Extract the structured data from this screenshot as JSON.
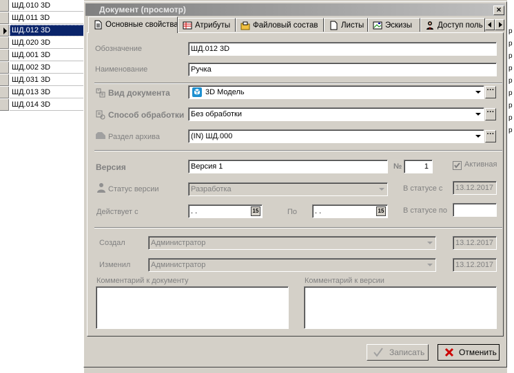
{
  "list": {
    "rows": [
      "ШД.010 3D",
      "ШД.011 3D",
      "ШД.012 3D",
      "ШД.020 3D",
      "ШД.001 3D",
      "ШД.002 3D",
      "ШД.031 3D",
      "ШД.013 3D",
      "ШД.014 3D"
    ],
    "selected_index": 2,
    "right_column_fragments": [
      "p",
      "p",
      "p",
      "p",
      "p",
      "p",
      "p",
      "p",
      "p"
    ]
  },
  "dialog": {
    "title": "Документ (просмотр)",
    "close_label": "×",
    "tabs": [
      {
        "label": "Основные свойства",
        "icon": "document-icon",
        "active": true
      },
      {
        "label": "Атрибуты",
        "icon": "attributes-table-icon"
      },
      {
        "label": "Файловый состав",
        "icon": "folder-files-icon"
      },
      {
        "label": "Листы",
        "icon": "sheet-icon"
      },
      {
        "label": "Эскизы",
        "icon": "sketch-image-icon"
      },
      {
        "label": "Доступ поль",
        "icon": "user-access-icon"
      }
    ],
    "designation": {
      "label": "Обозначение",
      "value": "ШД.012 3D"
    },
    "name": {
      "label": "Наименование",
      "value": "Ручка"
    },
    "doc_type": {
      "label": "Вид документа",
      "value": "3D Модель",
      "icon": "3d-model-cube-icon",
      "ellipsis": "···"
    },
    "processing": {
      "label": "Способ обработки",
      "value": "Без обработки",
      "ellipsis": "···"
    },
    "archive_section": {
      "label": "Раздел архива",
      "value": "(IN) ШД.000",
      "ellipsis": "···"
    },
    "version": {
      "label": "Версия",
      "value": "Версия 1",
      "number_label": "№",
      "number": "1"
    },
    "active": {
      "label": "Активная",
      "checked": true
    },
    "version_status": {
      "label": "Статус версии",
      "value": "Разработка"
    },
    "in_status_since": {
      "label": "В статусе с",
      "value": "13.12.2017"
    },
    "valid_from": {
      "label": "Действует с",
      "value": ". .",
      "cal": "15"
    },
    "valid_to": {
      "label": "По",
      "value": ". .",
      "cal": "15"
    },
    "in_status_until": {
      "label": "В статусе по",
      "value": ""
    },
    "created": {
      "label": "Создал",
      "user": "Администратор",
      "date": "13.12.2017"
    },
    "modified": {
      "label": "Изменил",
      "user": "Администратор",
      "date": "13.12.2017"
    },
    "doc_comment": {
      "label": "Комментарий к документу",
      "value": ""
    },
    "version_comment": {
      "label": "Комментарий к версии",
      "value": ""
    },
    "save_button": "Записать",
    "cancel_button": "Отменить"
  },
  "colors": {
    "selection": "#0a246a",
    "cancel_icon": "#cc0000",
    "window_bg": "#d4d0c8"
  }
}
